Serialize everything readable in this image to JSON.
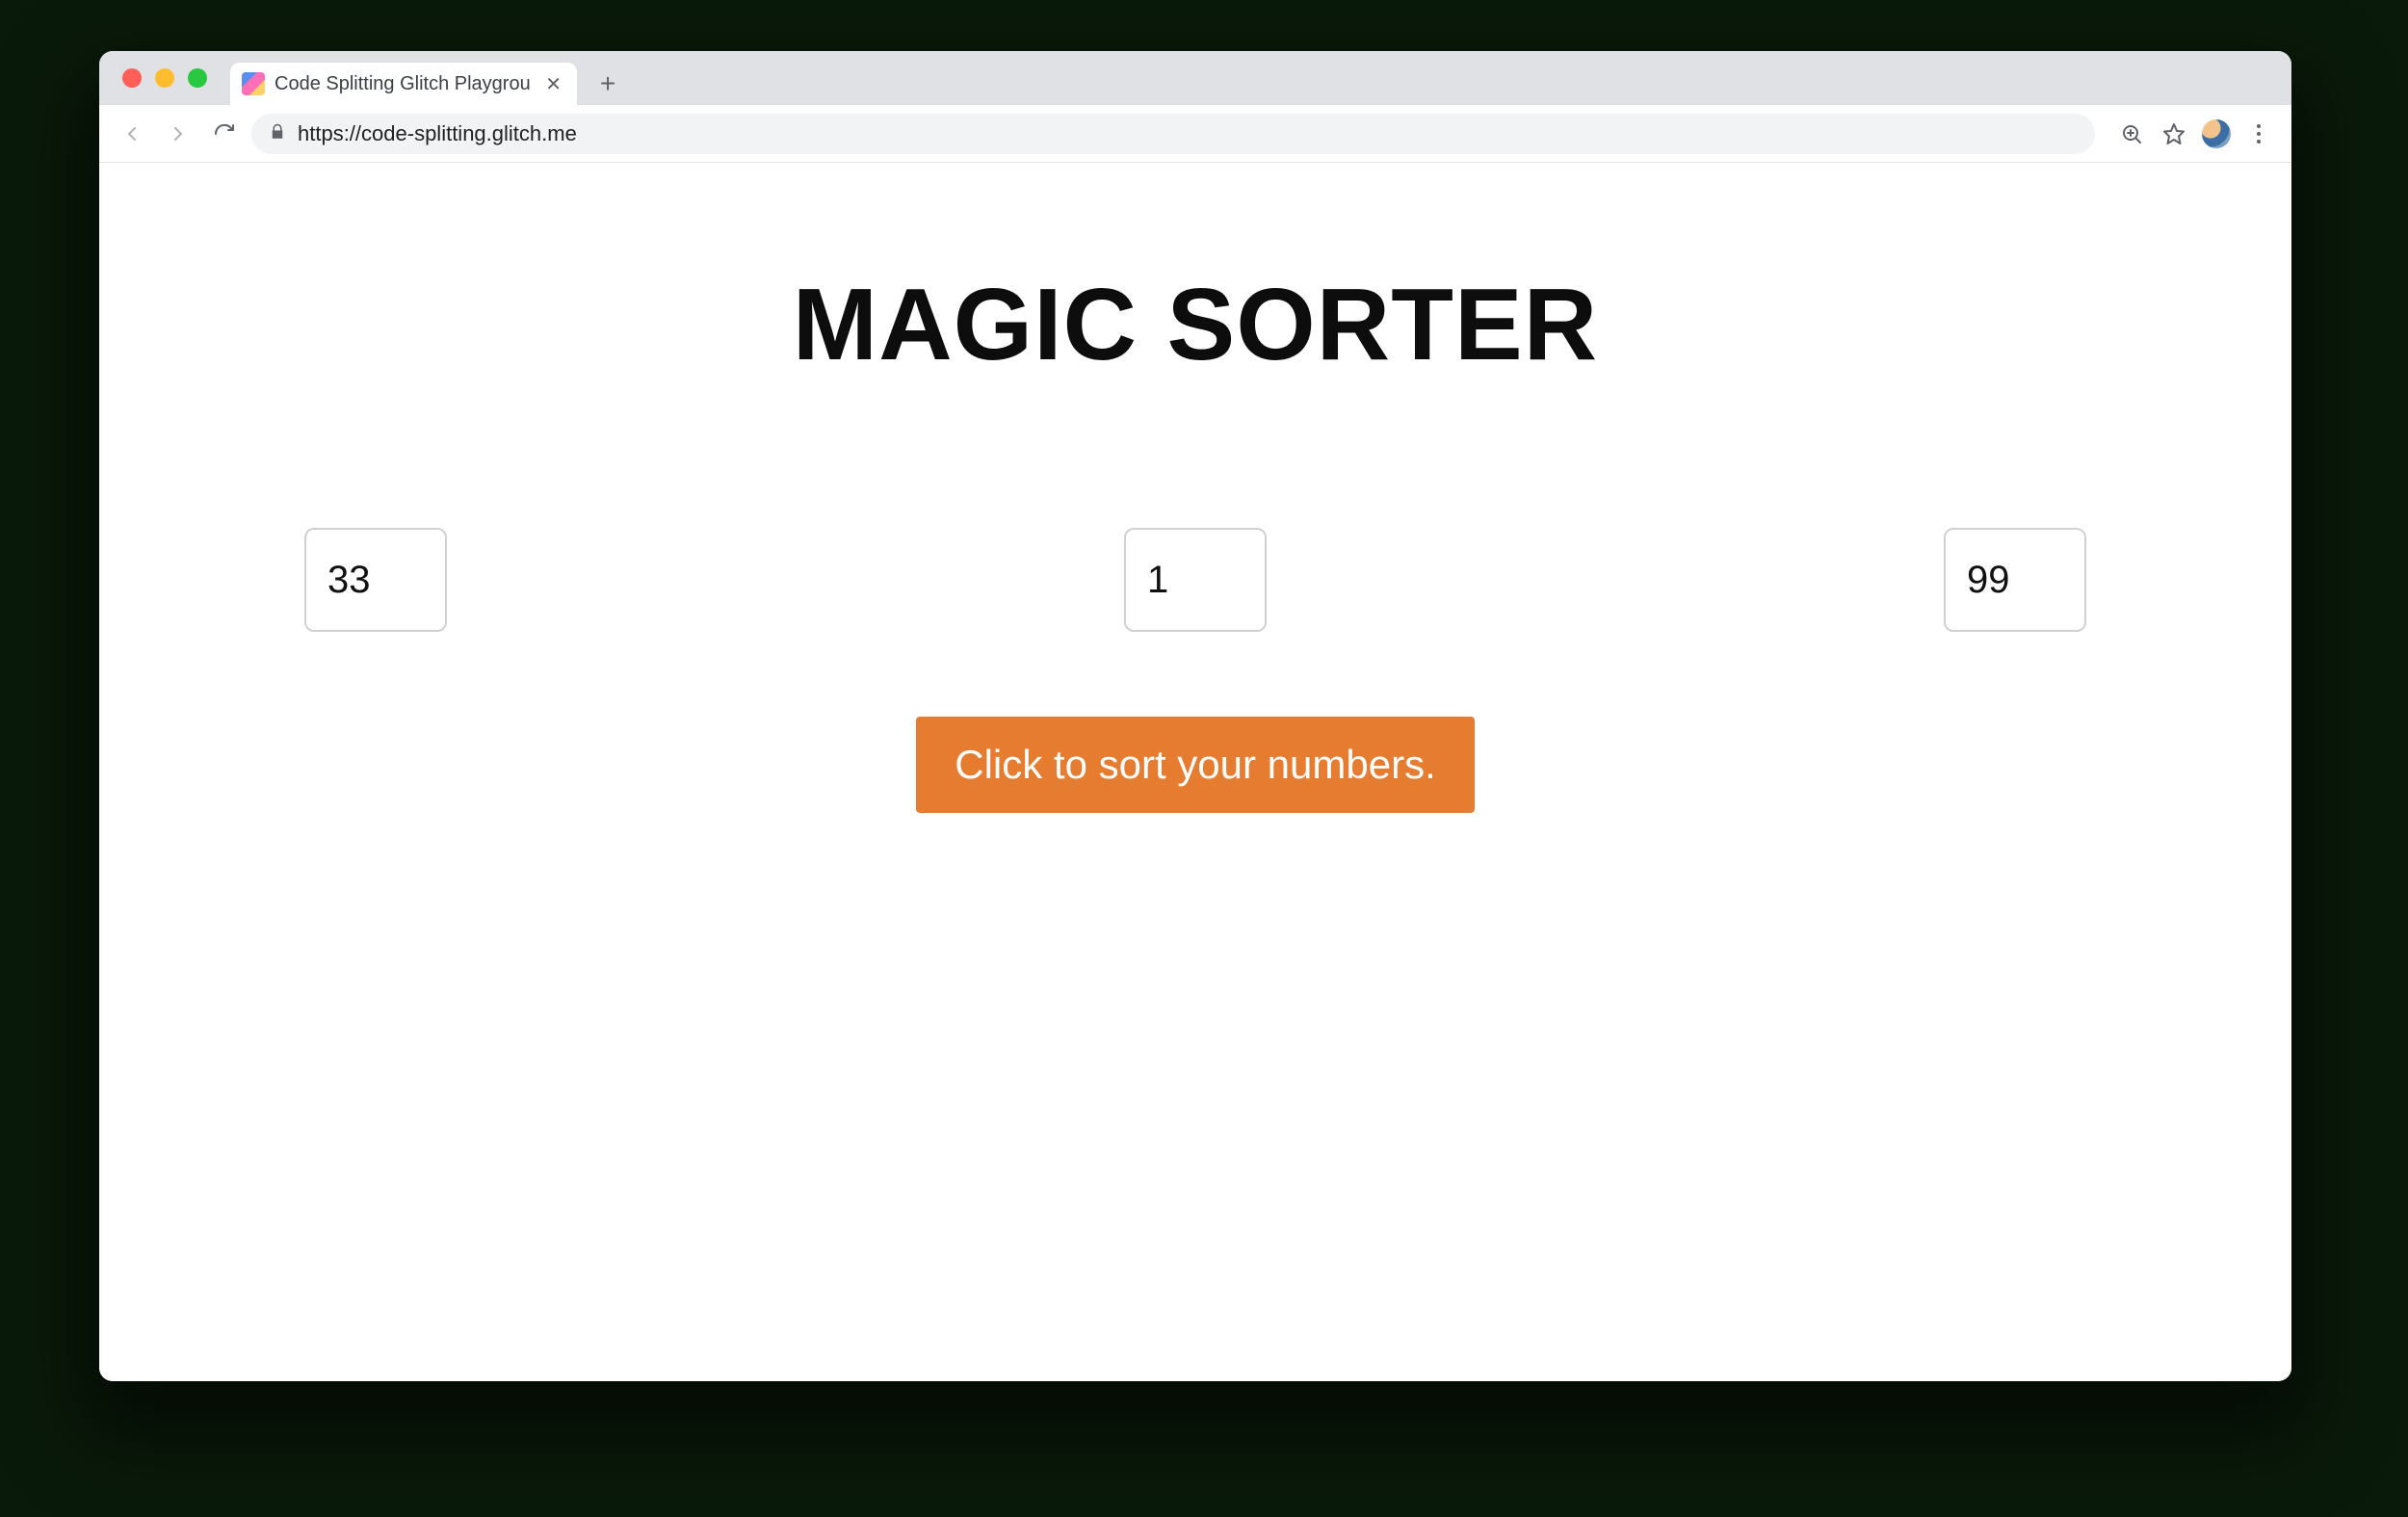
{
  "browser": {
    "tab": {
      "title": "Code Splitting Glitch Playgroun"
    },
    "url": "https://code-splitting.glitch.me"
  },
  "page": {
    "heading": "MAGIC SORTER",
    "inputs": {
      "a": "33",
      "b": "1",
      "c": "99"
    },
    "button_label": "Click to sort your numbers."
  },
  "colors": {
    "accent": "#e67c30"
  }
}
